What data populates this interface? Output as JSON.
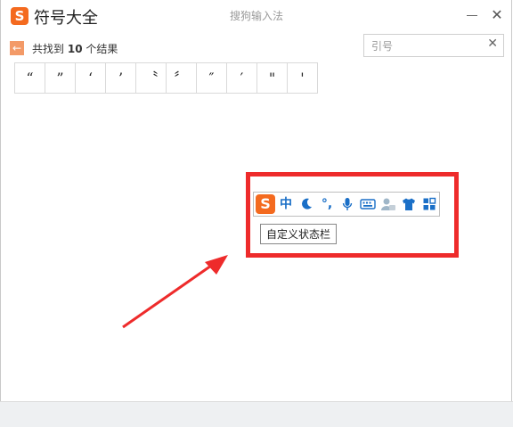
{
  "app": {
    "logo_letter": "S",
    "title": "符号大全",
    "window_title": "搜狗输入法"
  },
  "results": {
    "text_prefix": "共找到",
    "count": "10",
    "text_suffix": "个结果"
  },
  "search": {
    "value": "引号",
    "clear_label": "✕"
  },
  "symbols": [
    "“",
    "”",
    "‘",
    "’",
    "〝",
    "〞",
    "″",
    "′",
    "\"",
    "'"
  ],
  "status_bar": {
    "logo_letter": "S",
    "items": [
      {
        "name": "chinese-mode",
        "label": "中"
      },
      {
        "name": "half-width-moon-icon"
      },
      {
        "name": "punctuation-icon",
        "label": "°,"
      },
      {
        "name": "microphone-icon"
      },
      {
        "name": "keyboard-icon"
      },
      {
        "name": "user-avatar-icon"
      },
      {
        "name": "skin-shirt-icon"
      },
      {
        "name": "toolbox-grid-icon"
      }
    ],
    "tooltip": "自定义状态栏"
  },
  "colors": {
    "brand": "#f46a1f",
    "highlight": "#ee2b2b",
    "status_icon": "#1a6fc7"
  }
}
